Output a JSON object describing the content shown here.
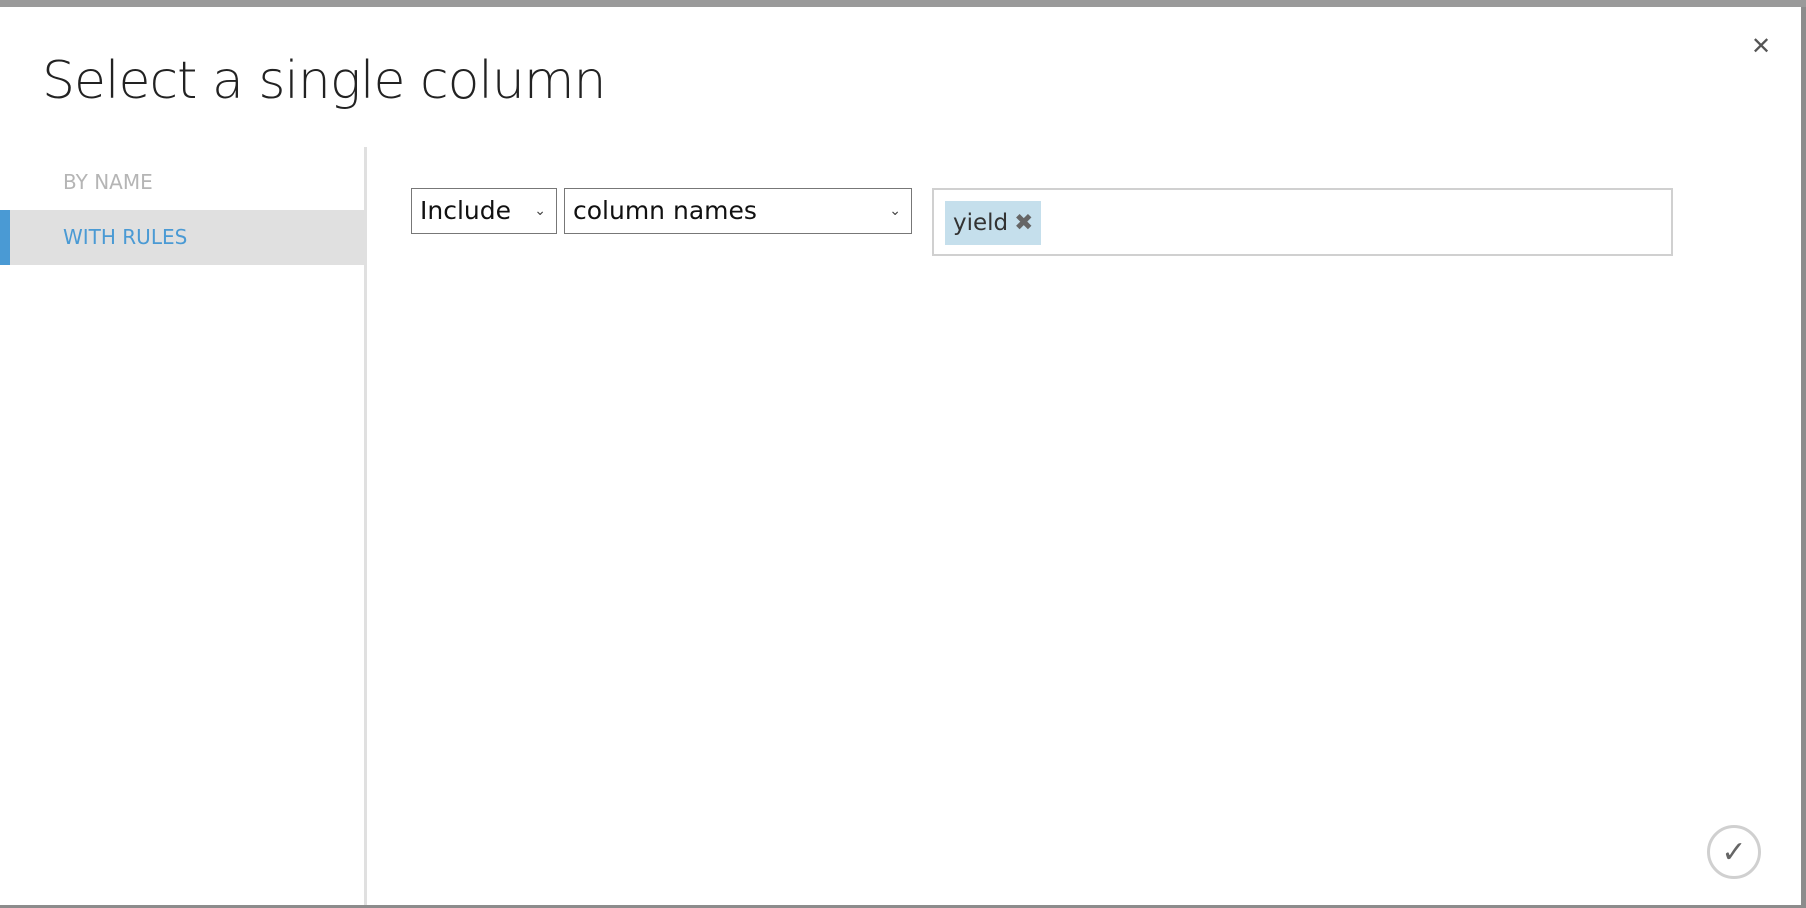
{
  "dialog": {
    "title": "Select a single column",
    "close_icon": "close-icon",
    "ok_icon": "checkmark-icon"
  },
  "sidebar": {
    "items": [
      {
        "label": "BY NAME",
        "active": false
      },
      {
        "label": "WITH RULES",
        "active": true
      }
    ]
  },
  "rule": {
    "mode": "Include",
    "type": "column names",
    "tags": [
      {
        "label": "yield"
      }
    ],
    "remove_glyph": "✖",
    "chevron": "⌄"
  },
  "colors": {
    "accent": "#4a9ad4",
    "chip_bg": "#c5dfec",
    "active_bg": "#e0e0e0"
  }
}
